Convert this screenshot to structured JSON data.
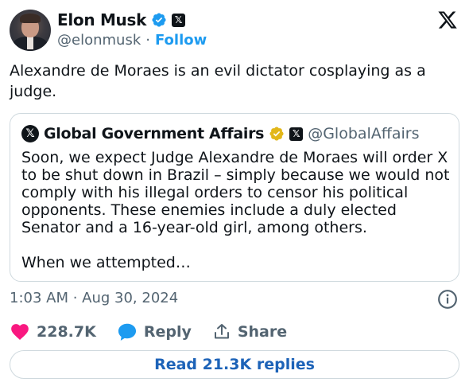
{
  "author": {
    "name": "Elon Musk",
    "handle": "@elonmusk",
    "separator": "·",
    "follow_label": "Follow"
  },
  "tweet": {
    "text": "Alexandre de Moraes is an evil dictator cosplaying as a judge."
  },
  "quote": {
    "name": "Global Government Affairs",
    "handle": "@GlobalAffairs",
    "body": "Soon, we expect Judge Alexandre de Moraes will order X to be shut down in Brazil – simply because we would not comply with his illegal orders to censor his political opponents. These enemies include a duly elected Senator and a 16-year-old girl, among others.",
    "more": "When we attempted…"
  },
  "meta": {
    "timestamp": "1:03 AM · Aug 30, 2024"
  },
  "actions": {
    "likes": "228.7K",
    "reply_label": "Reply",
    "share_label": "Share"
  },
  "replies_button": "Read 21.3K replies",
  "colors": {
    "accent": "#1d9bf0",
    "like": "#f91880",
    "verified_blue": "#1d9bf0",
    "verified_gold": "#e2b719",
    "text_secondary": "#536471",
    "border": "#cfd9de"
  },
  "icons": [
    "verified-badge-icon",
    "x-affiliate-icon",
    "x-logo-icon",
    "info-icon",
    "heart-icon",
    "reply-bubble-icon",
    "share-icon"
  ]
}
